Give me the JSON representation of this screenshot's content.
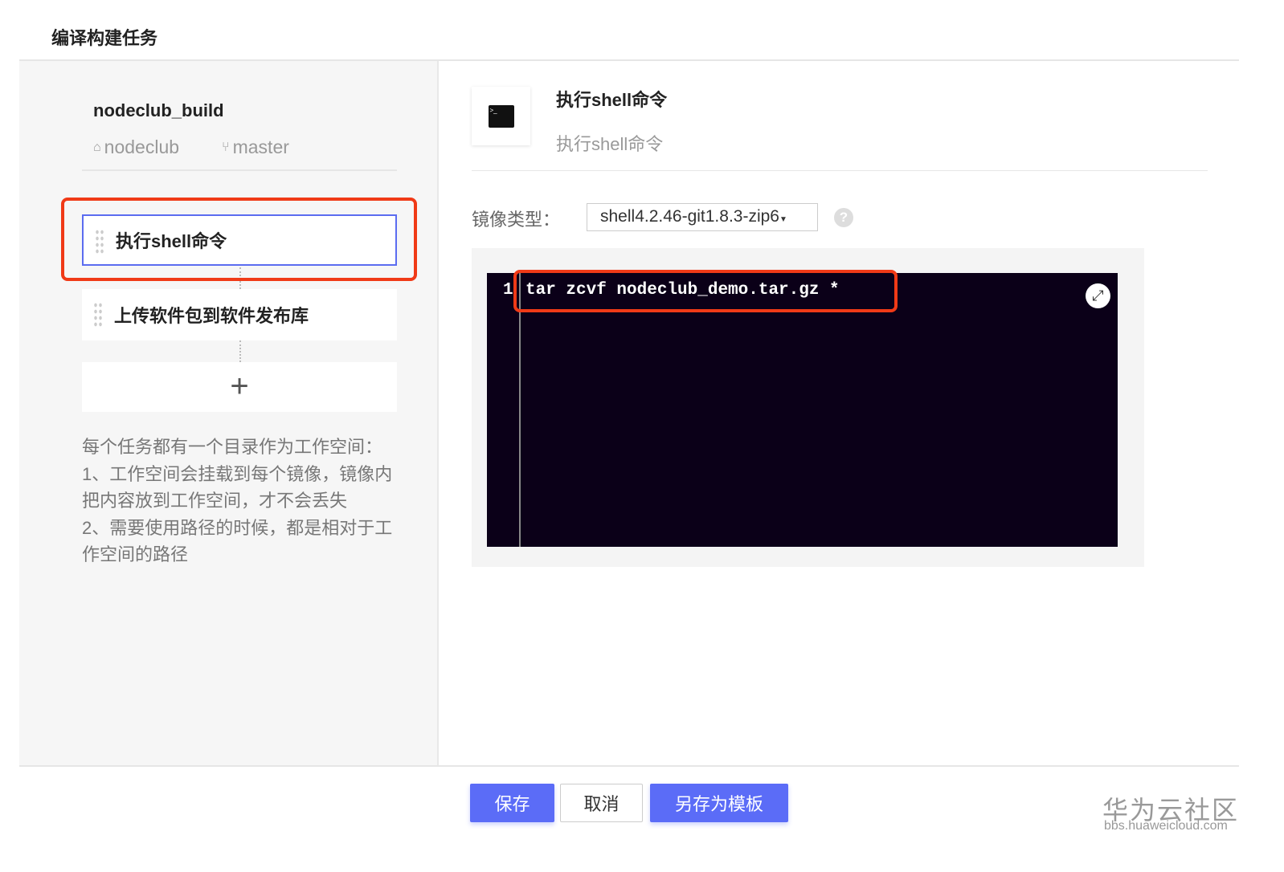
{
  "page": {
    "title": "编译构建任务"
  },
  "task": {
    "name": "nodeclub_build",
    "repo": "nodeclub",
    "branch": "master"
  },
  "steps": [
    {
      "label": "执行shell命令"
    },
    {
      "label": "上传软件包到软件发布库"
    }
  ],
  "add_label": "+",
  "help": [
    "每个任务都有一个目录作为工作空间：",
    "1、工作空间会挂载到每个镜像，镜像内把内容放到工作空间，才不会丢失",
    "2、需要使用路径的时候，都是相对于工作空间的路径"
  ],
  "detail": {
    "title": "执行shell命令",
    "subtitle": "执行shell命令",
    "image_label": "镜像类型：",
    "image_value": "shell4.2.46-git1.8.3-zip6",
    "help_icon": "?"
  },
  "editor": {
    "line_number": "1",
    "code": "tar zcvf nodeclub_demo.tar.gz *"
  },
  "buttons": {
    "save": "保存",
    "cancel": "取消",
    "save_template": "另存为模板"
  },
  "watermark": {
    "title": "华为云社区",
    "url": "bbs.huaweicloud.com"
  },
  "colors": {
    "accent": "#5b6cf7",
    "highlight": "#f03a17",
    "editor_bg": "#0b0018"
  }
}
